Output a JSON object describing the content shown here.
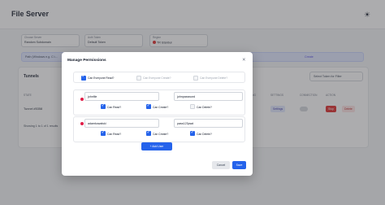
{
  "app": {
    "title": "File Server",
    "theme_icon": "sun-icon"
  },
  "form": {
    "server": {
      "label": "Choose Server",
      "value": "Random Subdomain"
    },
    "auth": {
      "label": "Auth Token",
      "value": "Default Token"
    },
    "region": {
      "label": "Region",
      "value": "TR Istanbul"
    },
    "path": {
      "placeholder": "Path (Windows e.g. C:\\...",
      "create_label": "Create"
    }
  },
  "tunnels": {
    "title": "Tunnels",
    "filter_placeholder": "Select Token for Filter",
    "columns": [
      "STATE",
      "FORWARDING",
      "SETTINGS",
      "CONNECTION",
      "ACTION"
    ],
    "rows": [
      {
        "name": "Tunnel #5358",
        "edit": "Edit",
        "settings": "Settings",
        "stop": "Stop",
        "delete": "Delete"
      }
    ],
    "pager": "Showing 1 to 1 of 1 results"
  },
  "modal": {
    "title": "Manage Permissions",
    "close_icon": "close-icon",
    "everyone": [
      {
        "label": "Can Everyone Read?",
        "checked": true,
        "disabled": false
      },
      {
        "label": "Can Everyone Create?",
        "checked": false,
        "disabled": true
      },
      {
        "label": "Can Everyone Delete?",
        "checked": false,
        "disabled": true
      }
    ],
    "users": [
      {
        "username": "johnfile",
        "password": "johnpassword",
        "perms": [
          {
            "label": "Can Read?",
            "checked": true
          },
          {
            "label": "Can Create?",
            "checked": true
          },
          {
            "label": "Can Delete?",
            "checked": false
          }
        ]
      },
      {
        "username": "adamkowalski",
        "password": "pass123pwd",
        "perms": [
          {
            "label": "Can Read?",
            "checked": true
          },
          {
            "label": "Can Create?",
            "checked": true
          },
          {
            "label": "Can Delete?",
            "checked": true
          }
        ]
      }
    ],
    "add_user_label": "+ Add User",
    "cancel_label": "Cancel",
    "save_label": "Save"
  },
  "colors": {
    "primary": "#2563eb",
    "danger": "#dc2626",
    "overlay": "#46464b"
  }
}
